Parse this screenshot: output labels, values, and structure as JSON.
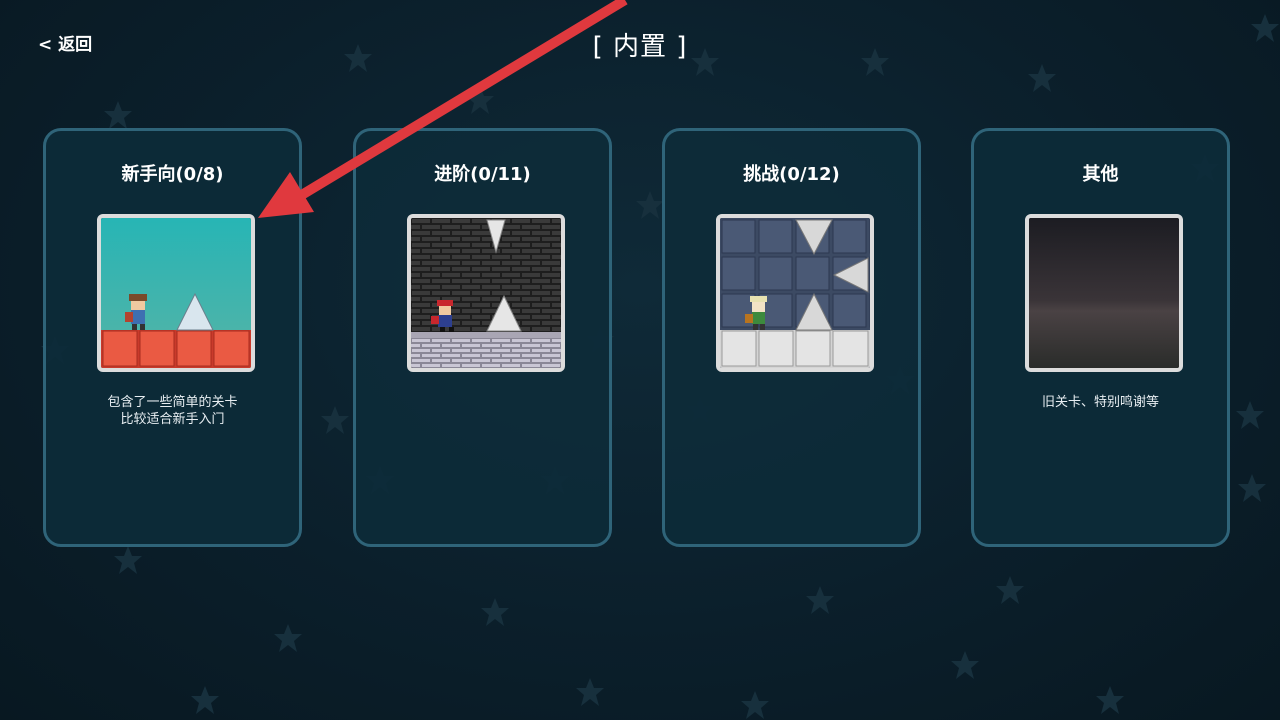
{
  "header": {
    "back_label": "< 返回",
    "title": "[ 内置 ]"
  },
  "cards": [
    {
      "title": "新手向(0/8)",
      "desc_line1": "包含了一些简单的关卡",
      "desc_line2": "比较适合新手入门"
    },
    {
      "title": "进阶(0/11)",
      "desc_line1": "",
      "desc_line2": ""
    },
    {
      "title": "挑战(0/12)",
      "desc_line1": "",
      "desc_line2": ""
    },
    {
      "title": "其他",
      "desc_line1": "旧关卡、特别鸣谢等",
      "desc_line2": ""
    }
  ],
  "colors": {
    "background": "#0b1f2b",
    "card_border": "#2f6479",
    "annotation_arrow": "#e0393e"
  }
}
